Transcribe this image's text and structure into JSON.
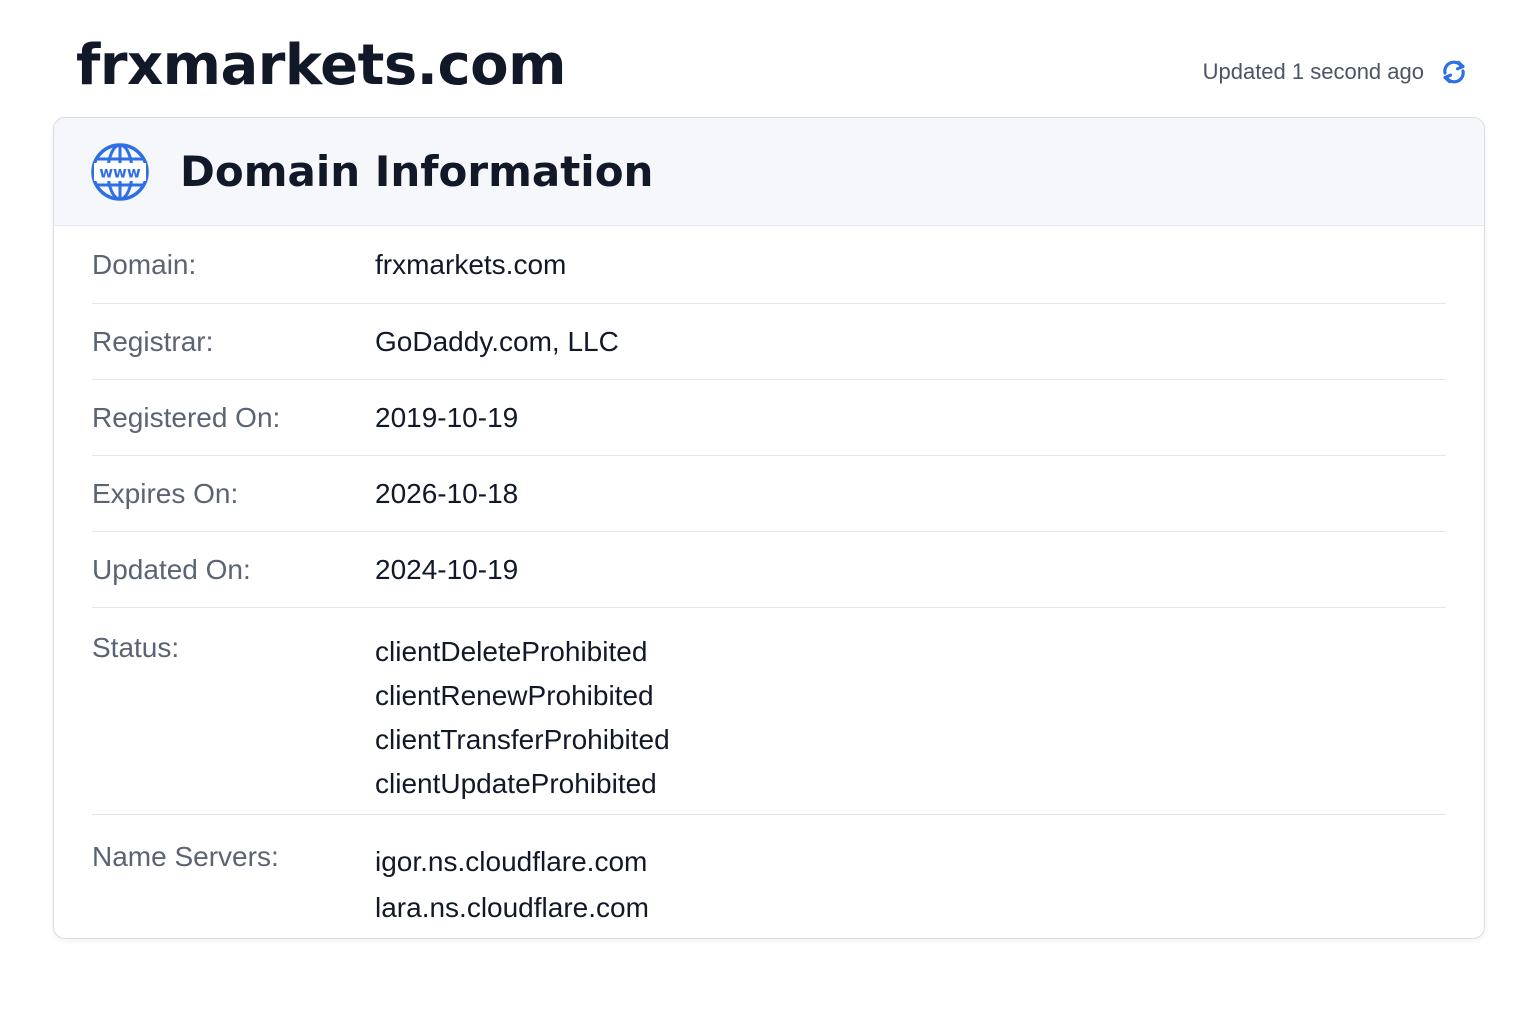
{
  "page": {
    "title": "frxmarkets.com",
    "updated_text": "Updated 1 second ago"
  },
  "card": {
    "title": "Domain Information",
    "icon_text": "www",
    "rows": {
      "domain": {
        "label": "Domain:",
        "value": "frxmarkets.com"
      },
      "registrar": {
        "label": "Registrar:",
        "value": "GoDaddy.com, LLC"
      },
      "registered_on": {
        "label": "Registered On:",
        "value": "2019-10-19"
      },
      "expires_on": {
        "label": "Expires On:",
        "value": "2026-10-18"
      },
      "updated_on": {
        "label": "Updated On:",
        "value": "2024-10-19"
      },
      "status": {
        "label": "Status:",
        "values": [
          "clientDeleteProhibited",
          "clientRenewProhibited",
          "clientTransferProhibited",
          "clientUpdateProhibited"
        ]
      },
      "name_servers": {
        "label": "Name Servers:",
        "values": [
          "igor.ns.cloudflare.com",
          "lara.ns.cloudflare.com"
        ]
      }
    }
  },
  "icons": {
    "refresh": "refresh-icon",
    "globe": "globe-www-icon"
  },
  "colors": {
    "accent": "#2f6fe4",
    "header_bg": "#f6f7fb",
    "label": "#5b6472",
    "value": "#111827"
  }
}
